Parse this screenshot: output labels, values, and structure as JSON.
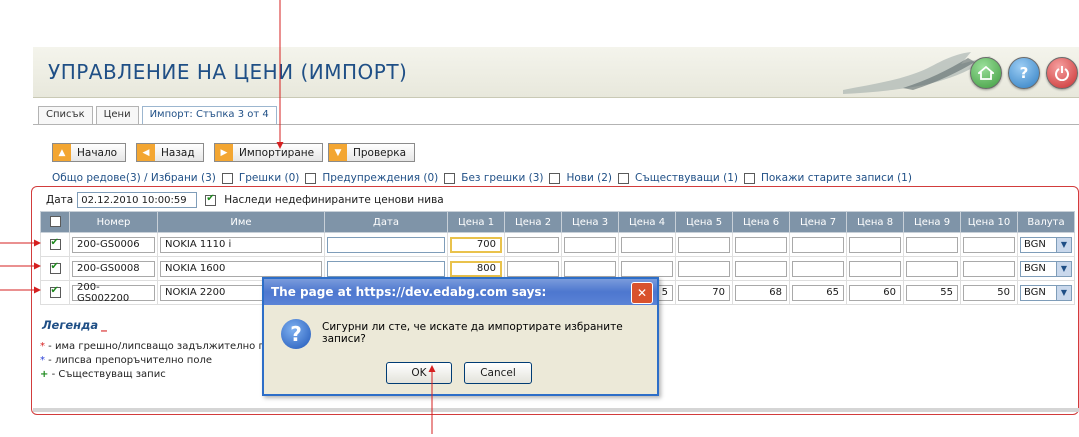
{
  "header": {
    "title": "УПРАВЛЕНИЕ НА ЦЕНИ (ИМПОРТ)"
  },
  "tabs": [
    {
      "label": "Списък"
    },
    {
      "label": "Цени"
    },
    {
      "label": "Импорт: Стъпка 3 от 4"
    }
  ],
  "toolbar": {
    "start": "Начало",
    "back": "Назад",
    "import": "Импортиране",
    "check": "Проверка"
  },
  "filters": {
    "summary": "Общо редове(3) / Избрани (3)",
    "errors": "Грешки (0)",
    "warnings": "Предупреждения (0)",
    "no_errors": "Без грешки (3)",
    "new": "Нови (2)",
    "existing": "Съществуващи (1)",
    "show_old": "Покажи старите записи (1)"
  },
  "date_row": {
    "label": "Дата",
    "value": "02.12.2010 10:00:59",
    "inherit_label": "Наследи недефинираните ценови нива"
  },
  "table": {
    "headers": [
      "Номер",
      "Име",
      "Дата",
      "Цена 1",
      "Цена 2",
      "Цена 3",
      "Цена 4",
      "Цена 5",
      "Цена 6",
      "Цена 7",
      "Цена 8",
      "Цена 9",
      "Цена 10",
      "Валута"
    ],
    "rows": [
      {
        "number": "200-GS0006",
        "name": "NOKIA 1110 i",
        "date": "",
        "p1": "700",
        "p2": "",
        "p3": "",
        "p4": "",
        "p5": "",
        "p6": "",
        "p7": "",
        "p8": "",
        "p9": "",
        "p10": "",
        "currency": "BGN"
      },
      {
        "number": "200-GS0008",
        "name": "NOKIA 1600",
        "date": "",
        "p1": "800",
        "p2": "",
        "p3": "",
        "p4": "",
        "p5": "",
        "p6": "",
        "p7": "",
        "p8": "",
        "p9": "",
        "p10": "",
        "currency": "BGN"
      },
      {
        "number": "200-GS002200",
        "name": "NOKIA 2200",
        "date": "",
        "p1": "",
        "p2": "",
        "p3": "",
        "p4": "5",
        "p5": "70",
        "p6": "68",
        "p7": "65",
        "p8": "60",
        "p9": "55",
        "p10": "50",
        "currency": "BGN"
      }
    ]
  },
  "legend": {
    "title": "Легенда",
    "items": [
      {
        "symbol": "*",
        "text": " - има грешно/липсващо задължително по..."
      },
      {
        "symbol": "*",
        "text": " - липсва препоръчително поле"
      },
      {
        "symbol": "+",
        "text": " - Съществуващ запис"
      }
    ]
  },
  "dialog": {
    "title": "The page at https://dev.edabg.com says:",
    "message": "Сигурни ли сте, че искате да импортирате избраните записи?",
    "ok": "OK",
    "cancel": "Cancel"
  },
  "colors": {
    "accent": "#1f4f86",
    "header_bg": "#7f94a8",
    "button_icon": "#f3a632",
    "annotation": "#d62020"
  }
}
